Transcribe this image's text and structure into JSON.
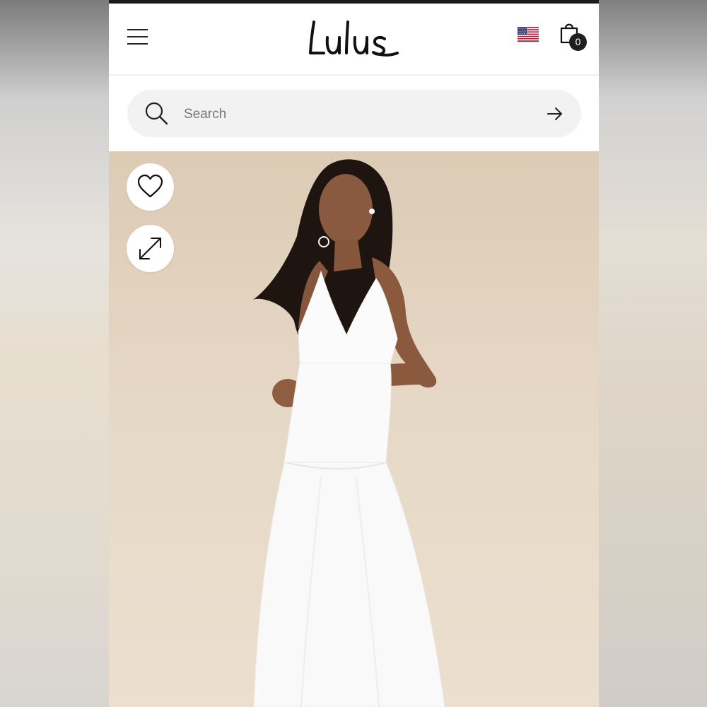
{
  "brand": {
    "logo_text": "Lulus"
  },
  "header": {
    "menu_icon": "hamburger-menu-icon",
    "region_icon": "us-flag-icon",
    "cart_icon": "shopping-bag-icon",
    "cart_count": "0"
  },
  "search": {
    "placeholder": "Search",
    "value": "",
    "search_icon": "magnifier-icon",
    "submit_icon": "arrow-right-icon"
  },
  "product_image": {
    "favorite_icon": "heart-outline-icon",
    "expand_icon": "expand-arrows-icon"
  },
  "colors": {
    "background": "#ffffff",
    "search_bg": "#f2f2f2",
    "hero_bg": "#e3d3bf",
    "text_dark": "#1f1f1f"
  }
}
